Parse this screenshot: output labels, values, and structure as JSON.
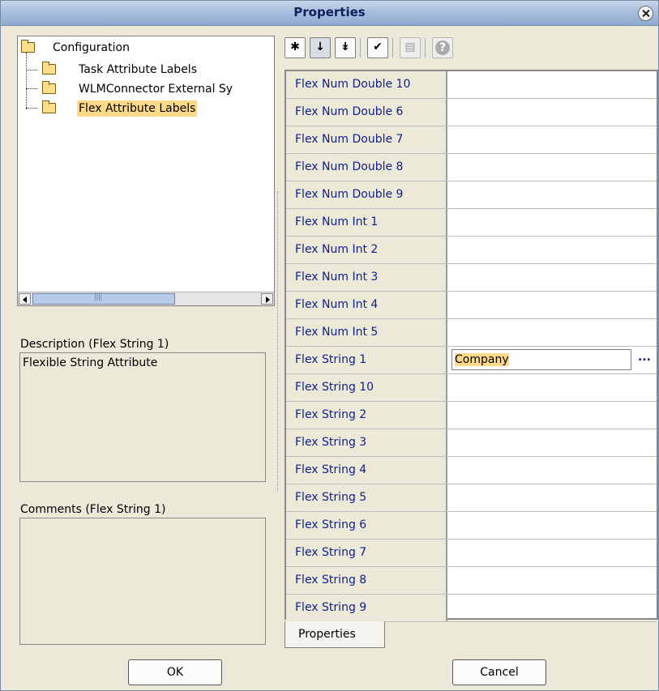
{
  "window": {
    "title": "Properties"
  },
  "tree": {
    "root": "Configuration",
    "children": [
      "Task Attribute Labels",
      "WLMConnector External Sy",
      "Flex Attribute Labels"
    ]
  },
  "description": {
    "label": "Description (Flex String 1)",
    "text": "Flexible String Attribute"
  },
  "comments": {
    "label": "Comments (Flex String 1)",
    "text": ""
  },
  "toolbar": {
    "buttons": [
      {
        "icon": "categorized-icon",
        "glyph": "✱"
      },
      {
        "icon": "sort-alphabetical-icon",
        "glyph": "↓"
      },
      {
        "icon": "sort-by-type-icon",
        "glyph": "↡"
      },
      {
        "icon": "show-descriptions-icon",
        "glyph": "✔"
      },
      {
        "icon": "edit-icon",
        "glyph": "▤"
      },
      {
        "icon": "help-icon",
        "glyph": "?"
      }
    ]
  },
  "properties": [
    {
      "name": "Flex Num Double 10",
      "value": ""
    },
    {
      "name": "Flex Num Double 6",
      "value": ""
    },
    {
      "name": "Flex Num Double 7",
      "value": ""
    },
    {
      "name": "Flex Num Double 8",
      "value": ""
    },
    {
      "name": "Flex Num Double 9",
      "value": ""
    },
    {
      "name": "Flex Num Int 1",
      "value": ""
    },
    {
      "name": "Flex Num Int 2",
      "value": ""
    },
    {
      "name": "Flex Num Int 3",
      "value": ""
    },
    {
      "name": "Flex Num Int 4",
      "value": ""
    },
    {
      "name": "Flex Num Int 5",
      "value": ""
    },
    {
      "name": "Flex String 1",
      "value": "Company"
    },
    {
      "name": "Flex String 10",
      "value": ""
    },
    {
      "name": "Flex String 2",
      "value": ""
    },
    {
      "name": "Flex String 3",
      "value": ""
    },
    {
      "name": "Flex String 4",
      "value": ""
    },
    {
      "name": "Flex String 5",
      "value": ""
    },
    {
      "name": "Flex String 6",
      "value": ""
    },
    {
      "name": "Flex String 7",
      "value": ""
    },
    {
      "name": "Flex String 8",
      "value": ""
    },
    {
      "name": "Flex String 9",
      "value": ""
    }
  ],
  "editing_row": 10,
  "ellipsis_label": "...",
  "tab": {
    "label": "Properties"
  },
  "buttons": {
    "ok": "OK",
    "cancel": "Cancel"
  }
}
